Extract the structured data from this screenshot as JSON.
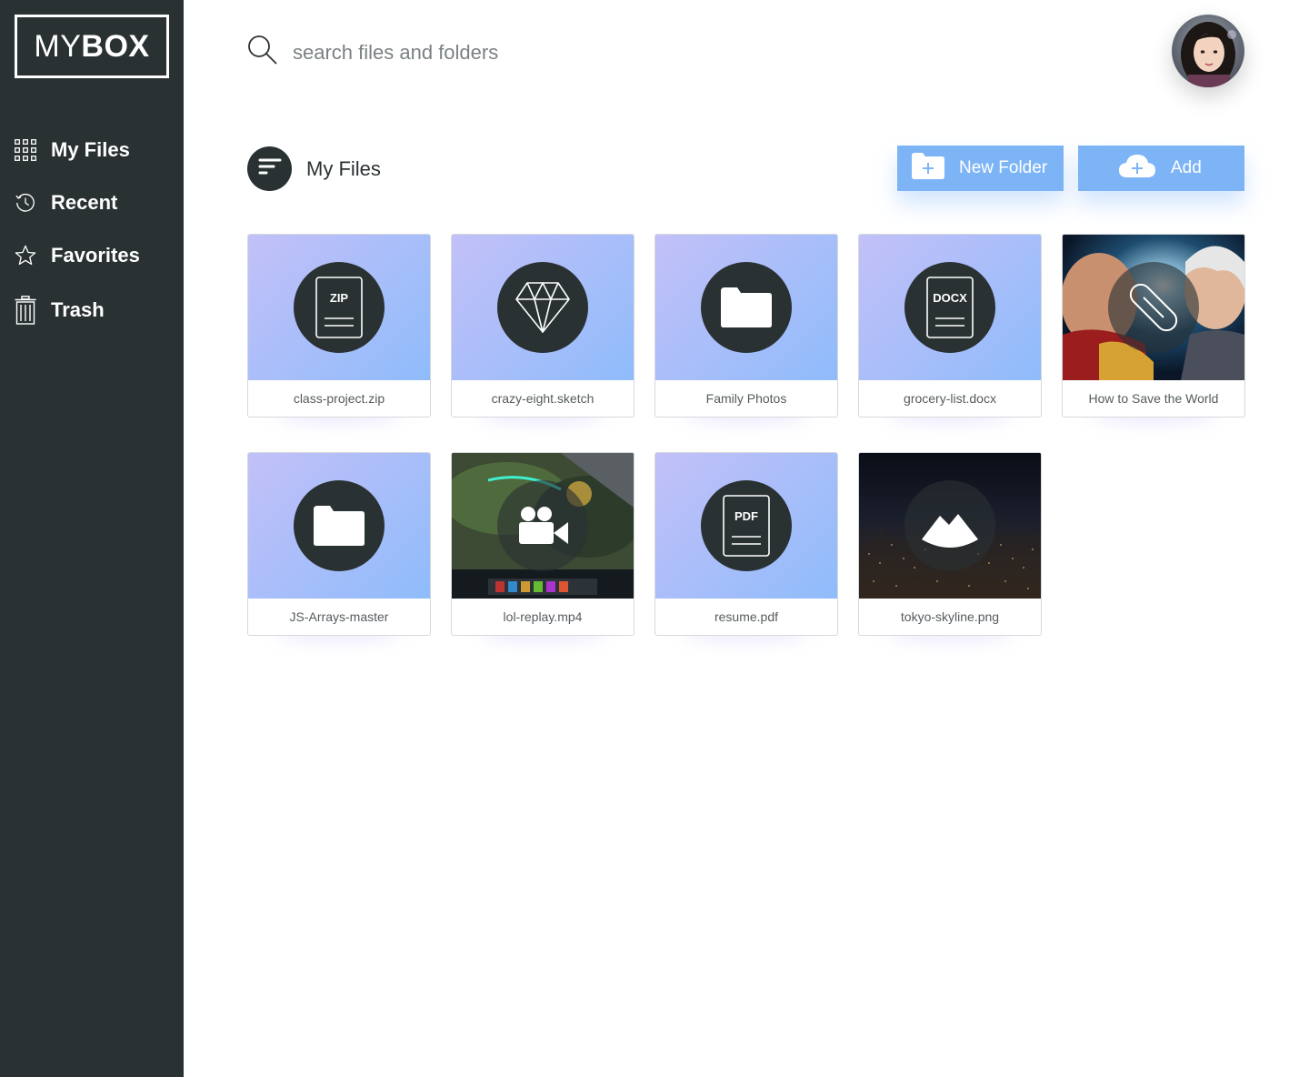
{
  "app": {
    "logo_thin": "MY",
    "logo_bold": "BOX"
  },
  "sidebar": {
    "items": [
      {
        "label": "My Files",
        "icon": "grid-icon"
      },
      {
        "label": "Recent",
        "icon": "clock-icon"
      },
      {
        "label": "Favorites",
        "icon": "star-icon"
      },
      {
        "label": "Trash",
        "icon": "trash-icon"
      }
    ]
  },
  "search": {
    "placeholder": "search files and folders",
    "value": ""
  },
  "header": {
    "title": "My Files",
    "new_folder_label": "New Folder",
    "add_label": "Add"
  },
  "files": [
    {
      "name": "class-project.zip",
      "type": "zip",
      "badge": "ZIP"
    },
    {
      "name": "crazy-eight.sketch",
      "type": "sketch"
    },
    {
      "name": "Family Photos",
      "type": "folder"
    },
    {
      "name": "grocery-list.docx",
      "type": "docx",
      "badge": "DOCX"
    },
    {
      "name": "How to Save the World",
      "type": "link"
    },
    {
      "name": "JS-Arrays-master",
      "type": "folder"
    },
    {
      "name": "lol-replay.mp4",
      "type": "video"
    },
    {
      "name": "resume.pdf",
      "type": "pdf",
      "badge": "PDF"
    },
    {
      "name": "tokyo-skyline.png",
      "type": "image"
    }
  ],
  "colors": {
    "sidebar_bg": "#2a3133",
    "accent": "#7db4f6",
    "thumb_gradient_start": "#c3c0f8",
    "thumb_gradient_end": "#8fbcfb"
  }
}
